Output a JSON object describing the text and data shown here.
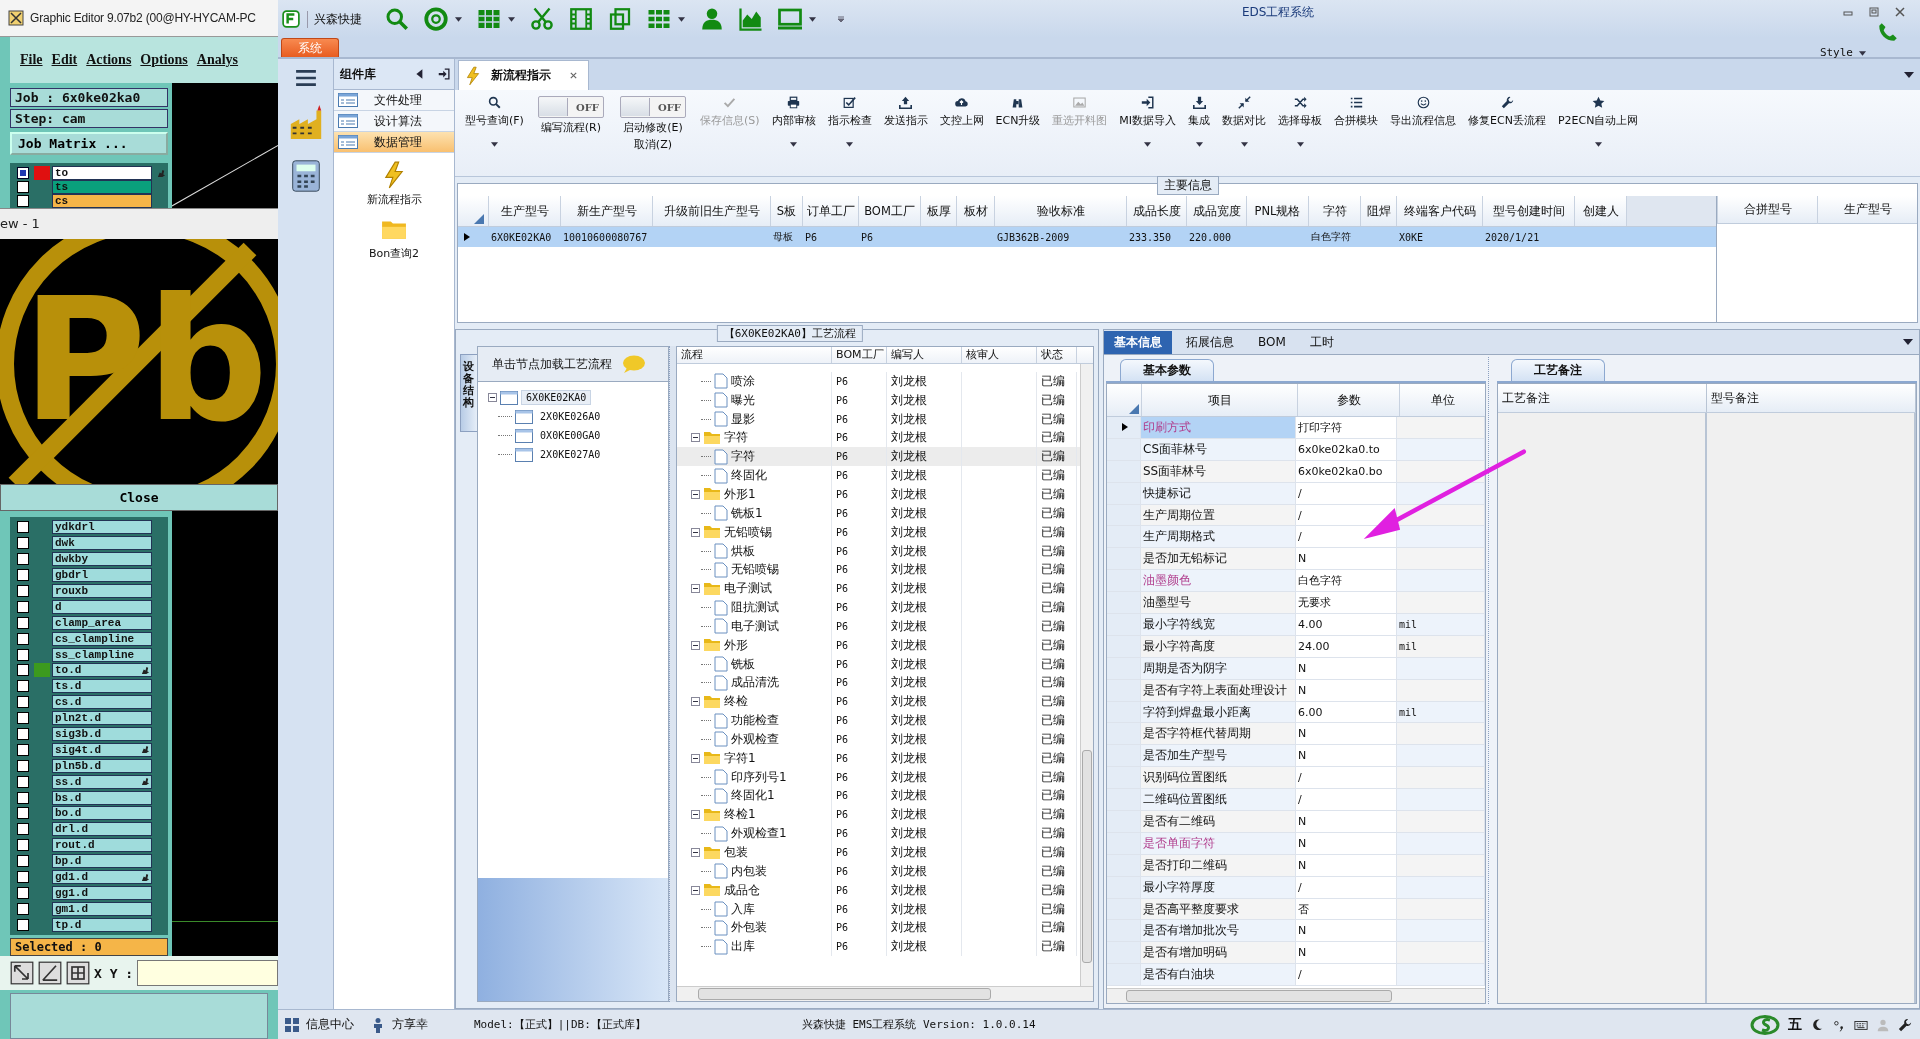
{
  "graphic_editor": {
    "title": "Graphic Editor 9.07b2 (00@HY-HYCAM-PC",
    "menu": [
      "File",
      "Edit",
      "Actions",
      "Options",
      "Analys"
    ],
    "job": "Job : 6x0ke02ka0",
    "step": "Step: cam",
    "job_matrix_button": "Job Matrix ...",
    "layers_top": [
      {
        "name": "to",
        "color": "#ffffff",
        "marker": {
          "color": "#e01010"
        },
        "active": true,
        "hand": true
      },
      {
        "name": "ts",
        "color": "#0aa07c",
        "active": false,
        "hand": false
      },
      {
        "name": "cs",
        "color": "#f5b548",
        "active": false,
        "hand": false
      }
    ],
    "view_window": {
      "title": "ew - 1",
      "symbol_text": "Pb",
      "close_button": "Close"
    },
    "layers": [
      {
        "name": "ydkdrl",
        "color": "#9fdcdc",
        "active": false,
        "hand": false
      },
      {
        "name": "dwk",
        "color": "#9fdcdc",
        "active": false,
        "hand": false
      },
      {
        "name": "dwkby",
        "color": "#9fdcdc",
        "active": false,
        "hand": false
      },
      {
        "name": "gbdrl",
        "color": "#9fdcdc",
        "active": false,
        "hand": false
      },
      {
        "name": "rouxb",
        "color": "#9fdcdc",
        "active": false,
        "hand": false
      },
      {
        "name": "d",
        "color": "#9fdcdc",
        "active": false,
        "hand": false
      },
      {
        "name": "clamp_area",
        "color": "#9fdcdc",
        "active": false,
        "hand": false
      },
      {
        "name": "cs_clampline",
        "color": "#9fdcdc",
        "active": false,
        "hand": false
      },
      {
        "name": "ss_clampline",
        "color": "#9fdcdc",
        "active": false,
        "hand": false
      },
      {
        "name": "to.d",
        "color": "#9fdcdc",
        "marker": {
          "color": "#3c9a1e"
        },
        "active": false,
        "hand": true
      },
      {
        "name": "ts.d",
        "color": "#9fdcdc",
        "active": false,
        "hand": false
      },
      {
        "name": "cs.d",
        "color": "#9fdcdc",
        "active": false,
        "hand": false
      },
      {
        "name": "pln2t.d",
        "color": "#9fdcdc",
        "active": false,
        "hand": false
      },
      {
        "name": "sig3b.d",
        "color": "#9fdcdc",
        "active": false,
        "hand": false
      },
      {
        "name": "sig4t.d",
        "color": "#9fdcdc",
        "active": false,
        "hand": true
      },
      {
        "name": "pln5b.d",
        "color": "#9fdcdc",
        "active": false,
        "hand": false
      },
      {
        "name": "ss.d",
        "color": "#9fdcdc",
        "active": false,
        "hand": true
      },
      {
        "name": "bs.d",
        "color": "#9fdcdc",
        "active": false,
        "hand": false
      },
      {
        "name": "bo.d",
        "color": "#9fdcdc",
        "active": false,
        "hand": false
      },
      {
        "name": "drl.d",
        "color": "#9fdcdc",
        "active": false,
        "hand": false
      },
      {
        "name": "rout.d",
        "color": "#9fdcdc",
        "active": false,
        "hand": false
      },
      {
        "name": "bp.d",
        "color": "#9fdcdc",
        "active": false,
        "hand": false
      },
      {
        "name": "gd1.d",
        "color": "#9fdcdc",
        "active": false,
        "hand": true
      },
      {
        "name": "gg1.d",
        "color": "#9fdcdc",
        "active": false,
        "hand": false
      },
      {
        "name": "gm1.d",
        "color": "#9fdcdc",
        "active": false,
        "hand": false
      },
      {
        "name": "tp.d",
        "color": "#9fdcdc",
        "active": false,
        "hand": false
      }
    ],
    "selected_count": "Selected : 0",
    "xy_label": "X Y :"
  },
  "app": {
    "quick_access_label": "兴森快捷",
    "title": "EDS工程系统",
    "system_tab": "系统",
    "style_menu": "Style"
  },
  "sidebar": {
    "header": "组件库",
    "items": [
      {
        "label": "文件处理",
        "selected": false
      },
      {
        "label": "设计算法",
        "selected": false
      },
      {
        "label": "数据管理",
        "selected": true
      }
    ],
    "shortcuts": [
      {
        "label": "新流程指示",
        "kind": "bolt"
      },
      {
        "label": "Bon查询2",
        "kind": "folder"
      }
    ]
  },
  "document_tabs": [
    {
      "label": "新流程指示",
      "selected": true
    }
  ],
  "ribbon": [
    {
      "kind": "button",
      "label": "型号查询(F)",
      "disabled": false,
      "dropdown": true
    },
    {
      "kind": "toggle",
      "label": "编写流程(R)",
      "toggle_text": "OFF",
      "on": false
    },
    {
      "kind": "toggle",
      "label": "启动修改(E)",
      "second_line": "取消(Z)",
      "toggle_text": "OFF",
      "on": false
    },
    {
      "kind": "button",
      "label": "保存信息(S)",
      "disabled": true,
      "dropdown": false
    },
    {
      "kind": "button",
      "label": "内部审核",
      "disabled": false,
      "dropdown": true
    },
    {
      "kind": "button",
      "label": "指示检查",
      "disabled": false,
      "dropdown": true
    },
    {
      "kind": "button",
      "label": "发送指示",
      "disabled": false,
      "dropdown": false
    },
    {
      "kind": "button",
      "label": "文控上网",
      "disabled": false,
      "dropdown": false
    },
    {
      "kind": "button",
      "label": "ECN升级",
      "disabled": false,
      "dropdown": false
    },
    {
      "kind": "button",
      "label": "重选开料图",
      "disabled": true,
      "dropdown": false
    },
    {
      "kind": "button",
      "label": "MI数据导入",
      "disabled": false,
      "dropdown": true
    },
    {
      "kind": "button",
      "label": "集成",
      "disabled": false,
      "dropdown": true
    },
    {
      "kind": "button",
      "label": "数据对比",
      "disabled": false,
      "dropdown": true
    },
    {
      "kind": "button",
      "label": "选择母板",
      "disabled": false,
      "dropdown": true
    },
    {
      "kind": "button",
      "label": "合拼模块",
      "disabled": false,
      "dropdown": false
    },
    {
      "kind": "button",
      "label": "导出流程信息",
      "disabled": false,
      "dropdown": false
    },
    {
      "kind": "button",
      "label": "修复ECN丢流程",
      "disabled": false,
      "dropdown": false
    },
    {
      "kind": "button",
      "label": "P2ECN自动上网",
      "disabled": false,
      "dropdown": true
    }
  ],
  "main_info": {
    "title": "主要信息",
    "columns": [
      "生产型号",
      "新生产型号",
      "升级前旧生产型号",
      "S板",
      "订单工厂",
      "BOM工厂",
      "板厚",
      "板材",
      "验收标准",
      "成品长度",
      "成品宽度",
      "PNL规格",
      "字符",
      "阻焊",
      "终端客户代码",
      "型号创建时间",
      "创建人"
    ],
    "rows": [
      {
        "selected": true,
        "cells": [
          "6X0KE02KA0",
          "10010600080767",
          null,
          "母板",
          "P6",
          "P6",
          null,
          null,
          "GJB362B-2009",
          "233.350",
          "220.000",
          null,
          "白色字符",
          null,
          "X0KE",
          "2020/1/21",
          null
        ]
      }
    ],
    "side_columns": [
      "合拼型号",
      "生产型号"
    ]
  },
  "process_panel": {
    "title": "【6X0KE02KA0】工艺流程",
    "vertical_tab": "设备结构",
    "tree_header": "单击节点加载工艺流程",
    "tree": [
      {
        "label": "6X0KE02KA0",
        "selected": true,
        "expanded": true,
        "children": [
          {
            "label": "2X0KE026A0",
            "selected": false
          },
          {
            "label": "0X0KE00GA0",
            "selected": false
          },
          {
            "label": "2X0KE027A0",
            "selected": false
          }
        ]
      }
    ],
    "columns": [
      "流程",
      "BOM工厂",
      "编写人",
      "核审人",
      "状态"
    ],
    "steps": [
      {
        "children": [
          {
            "label": "喷涂",
            "bom": "P6",
            "writer": "刘龙根",
            "status": "已编",
            "selected": false
          },
          {
            "label": "曝光",
            "bom": "P6",
            "writer": "刘龙根",
            "status": "已编",
            "selected": false
          },
          {
            "label": "显影",
            "bom": "P6",
            "writer": "刘龙根",
            "status": "已编",
            "selected": false
          }
        ]
      },
      {
        "label": "字符",
        "bom": "P6",
        "writer": "刘龙根",
        "status": "已编",
        "selected": false,
        "expanded": true,
        "children": [
          {
            "label": "字符",
            "bom": "P6",
            "writer": "刘龙根",
            "status": "已编",
            "selected": true
          },
          {
            "label": "终固化",
            "bom": "P6",
            "writer": "刘龙根",
            "status": "已编",
            "selected": false
          }
        ]
      },
      {
        "label": "外形1",
        "bom": "P6",
        "writer": "刘龙根",
        "status": "已编",
        "selected": false,
        "expanded": true,
        "children": [
          {
            "label": "铣板1",
            "bom": "P6",
            "writer": "刘龙根",
            "status": "已编",
            "selected": false
          }
        ]
      },
      {
        "label": "无铅喷锡",
        "bom": "P6",
        "writer": "刘龙根",
        "status": "已编",
        "selected": false,
        "expanded": true,
        "children": [
          {
            "label": "烘板",
            "bom": "P6",
            "writer": "刘龙根",
            "status": "已编",
            "selected": false
          },
          {
            "label": "无铅喷锡",
            "bom": "P6",
            "writer": "刘龙根",
            "status": "已编",
            "selected": false
          }
        ]
      },
      {
        "label": "电子测试",
        "bom": "P6",
        "writer": "刘龙根",
        "status": "已编",
        "selected": false,
        "expanded": true,
        "children": [
          {
            "label": "阻抗测试",
            "bom": "P6",
            "writer": "刘龙根",
            "status": "已编",
            "selected": false
          },
          {
            "label": "电子测试",
            "bom": "P6",
            "writer": "刘龙根",
            "status": "已编",
            "selected": false
          }
        ]
      },
      {
        "label": "外形",
        "bom": "P6",
        "writer": "刘龙根",
        "status": "已编",
        "selected": false,
        "expanded": true,
        "children": [
          {
            "label": "铣板",
            "bom": "P6",
            "writer": "刘龙根",
            "status": "已编",
            "selected": false
          },
          {
            "label": "成品清洗",
            "bom": "P6",
            "writer": "刘龙根",
            "status": "已编",
            "selected": false
          }
        ]
      },
      {
        "label": "终检",
        "bom": "P6",
        "writer": "刘龙根",
        "status": "已编",
        "selected": false,
        "expanded": true,
        "children": [
          {
            "label": "功能检查",
            "bom": "P6",
            "writer": "刘龙根",
            "status": "已编",
            "selected": false
          },
          {
            "label": "外观检查",
            "bom": "P6",
            "writer": "刘龙根",
            "status": "已编",
            "selected": false
          }
        ]
      },
      {
        "label": "字符1",
        "bom": "P6",
        "writer": "刘龙根",
        "status": "已编",
        "selected": false,
        "expanded": true,
        "children": [
          {
            "label": "印序列号1",
            "bom": "P6",
            "writer": "刘龙根",
            "status": "已编",
            "selected": false
          },
          {
            "label": "终固化1",
            "bom": "P6",
            "writer": "刘龙根",
            "status": "已编",
            "selected": false
          }
        ]
      },
      {
        "label": "终检1",
        "bom": "P6",
        "writer": "刘龙根",
        "status": "已编",
        "selected": false,
        "expanded": true,
        "children": [
          {
            "label": "外观检查1",
            "bom": "P6",
            "writer": "刘龙根",
            "status": "已编",
            "selected": false
          }
        ]
      },
      {
        "label": "包装",
        "bom": "P6",
        "writer": "刘龙根",
        "status": "已编",
        "selected": false,
        "expanded": true,
        "children": [
          {
            "label": "内包装",
            "bom": "P6",
            "writer": "刘龙根",
            "status": "已编",
            "selected": false
          }
        ]
      },
      {
        "label": "成品仓",
        "bom": "P6",
        "writer": "刘龙根",
        "status": "已编",
        "selected": false,
        "expanded": true,
        "children": [
          {
            "label": "入库",
            "bom": "P6",
            "writer": "刘龙根",
            "status": "已编",
            "selected": false
          },
          {
            "label": "外包装",
            "bom": "P6",
            "writer": "刘龙根",
            "status": "已编",
            "selected": false
          },
          {
            "label": "出库",
            "bom": "P6",
            "writer": "刘龙根",
            "status": "已编",
            "selected": false
          }
        ]
      }
    ]
  },
  "info_panel": {
    "tabs": [
      {
        "label": "基本信息",
        "selected": true
      },
      {
        "label": "拓展信息",
        "selected": false
      },
      {
        "label": "BOM",
        "selected": false
      },
      {
        "label": "工时",
        "selected": false
      }
    ],
    "params_tab": "基本参数",
    "params_columns": [
      "项目",
      "参数",
      "单位"
    ],
    "params": [
      {
        "item": "印刷方式",
        "value": "打印字符",
        "selected": true,
        "flagged": true
      },
      {
        "item": "CS面菲林号",
        "value": "6x0ke02ka0.to",
        "selected": false,
        "flagged": false
      },
      {
        "item": "SS面菲林号",
        "value": "6x0ke02ka0.bo",
        "selected": false,
        "flagged": false
      },
      {
        "item": "快捷标记",
        "value": "/",
        "selected": false,
        "flagged": false
      },
      {
        "item": "生产周期位置",
        "value": "/",
        "selected": false,
        "flagged": false
      },
      {
        "item": "生产周期格式",
        "value": "/",
        "selected": false,
        "flagged": false
      },
      {
        "item": "是否加无铅标记",
        "value": "N",
        "selected": false,
        "flagged": false
      },
      {
        "item": "油墨颜色",
        "value": "白色字符",
        "selected": false,
        "flagged": true
      },
      {
        "item": "油墨型号",
        "value": "无要求",
        "selected": false,
        "flagged": false
      },
      {
        "item": "最小字符线宽",
        "value": "4.00",
        "unit": "mil",
        "selected": false,
        "flagged": false
      },
      {
        "item": "最小字符高度",
        "value": "24.00",
        "unit": "mil",
        "selected": false,
        "flagged": false
      },
      {
        "item": "周期是否为阴字",
        "value": "N",
        "selected": false,
        "flagged": false
      },
      {
        "item": "是否有字符上表面处理设计",
        "value": "N",
        "selected": false,
        "flagged": false
      },
      {
        "item": "字符到焊盘最小距离",
        "value": "6.00",
        "unit": "mil",
        "selected": false,
        "flagged": false
      },
      {
        "item": "是否字符框代替周期",
        "value": "N",
        "selected": false,
        "flagged": false
      },
      {
        "item": "是否加生产型号",
        "value": "N",
        "selected": false,
        "flagged": false
      },
      {
        "item": "识别码位置图纸",
        "value": "/",
        "selected": false,
        "flagged": false
      },
      {
        "item": "二维码位置图纸",
        "value": "/",
        "selected": false,
        "flagged": false
      },
      {
        "item": "是否有二维码",
        "value": "N",
        "selected": false,
        "flagged": false
      },
      {
        "item": "是否单面字符",
        "value": "N",
        "selected": false,
        "flagged": true
      },
      {
        "item": "是否打印二维码",
        "value": "N",
        "selected": false,
        "flagged": false
      },
      {
        "item": "最小字符厚度",
        "value": "/",
        "selected": false,
        "flagged": false
      },
      {
        "item": "是否高平整度要求",
        "value": "否",
        "selected": false,
        "flagged": false
      },
      {
        "item": "是否有增加批次号",
        "value": "N",
        "selected": false,
        "flagged": false
      },
      {
        "item": "是否有增加明码",
        "value": "N",
        "selected": false,
        "flagged": false
      },
      {
        "item": "是否有白油块",
        "value": "/",
        "selected": false,
        "flagged": false
      }
    ],
    "notes_tab": "工艺备注",
    "notes_columns": [
      "工艺备注",
      "型号备注"
    ]
  },
  "status_bar": {
    "info_center": "信息中心",
    "user": "方享幸",
    "model": "Model:【正式】||DB:【正式库】",
    "version": "兴森快捷 EMS工程系统 Version: 1.0.0.14",
    "ime": "五"
  }
}
